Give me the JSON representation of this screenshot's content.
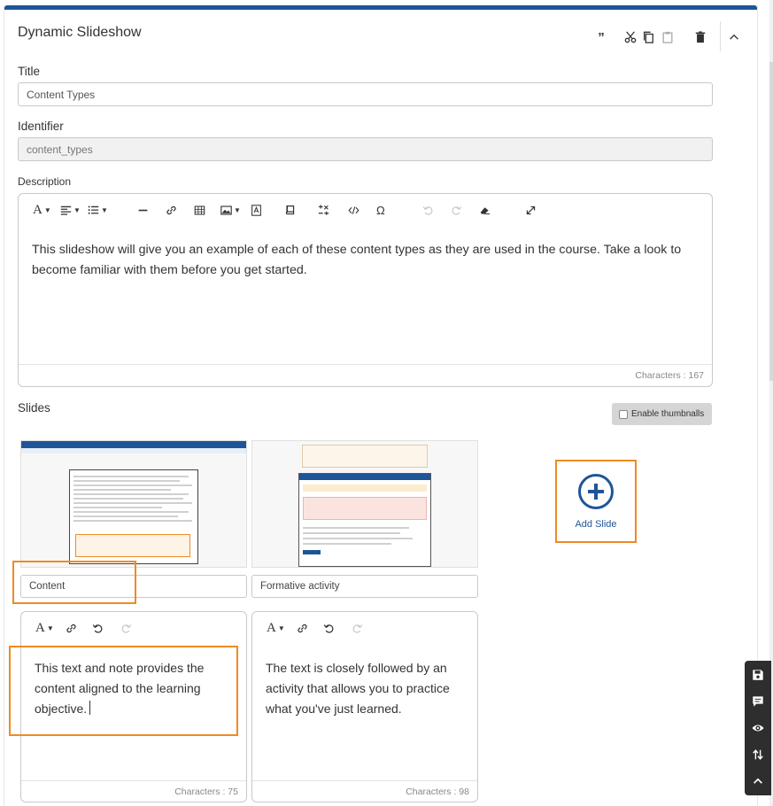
{
  "panel": {
    "title": "Dynamic Slideshow",
    "actions": [
      "quote-icon",
      "scissors-icon",
      "copy-icon",
      "paste-icon",
      "trash-icon",
      "chevron-up-icon"
    ]
  },
  "fields": {
    "title_label": "Title",
    "title_value": "Content Types",
    "identifier_label": "Identifier",
    "identifier_value": "content_types",
    "description_label": "Description"
  },
  "description_editor": {
    "text": "This slideshow will give you an example of each of these content types as they are used in the course. Take a look to become familiar with them before you get started.",
    "count_label": "Characters : 167"
  },
  "slides": {
    "label": "Slides",
    "thumbnail_toggle": "Enable thumbnalls",
    "add_label": "Add Slide",
    "items": [
      {
        "name": "Content",
        "text": "This text and note provides the content aligned to the learning objective.",
        "count_label": "Characters : 75"
      },
      {
        "name": "Formative activity",
        "text": "The text is closely followed by an activity that allows you to practice what you've just learned.",
        "count_label": "Characters : 98"
      }
    ]
  },
  "colors": {
    "accent": "#1f5598",
    "highlight": "#f08a24"
  }
}
